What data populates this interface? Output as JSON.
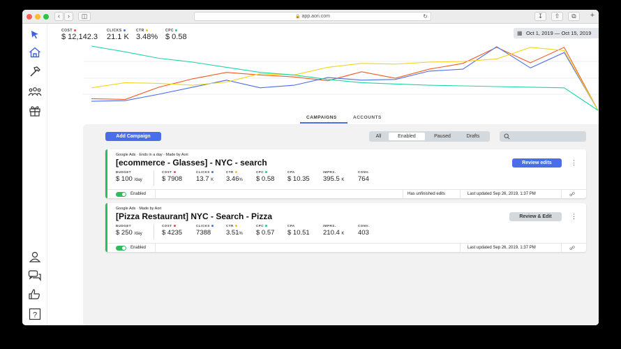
{
  "browser": {
    "url": "app.aori.com"
  },
  "header_metrics": [
    {
      "label": "COST",
      "value": "$ 12,142.3",
      "dot_color": "#e84a4a"
    },
    {
      "label": "CLICKS",
      "value": "21.1 K",
      "dot_color": "#4a6ee8"
    },
    {
      "label": "CTR",
      "value": "3.48%",
      "dot_color": "#f2c21b"
    },
    {
      "label": "CPC",
      "value": "$ 0.58",
      "dot_color": "#1bc9a0"
    }
  ],
  "date_range": "Oct 1, 2019 — Oct 15, 2019",
  "chart_data": {
    "type": "line",
    "series": [
      {
        "name": "COST",
        "color": "#f25a22",
        "values": [
          18,
          17,
          36,
          49,
          59,
          55,
          52,
          46,
          60,
          50,
          64,
          73,
          98,
          74,
          98,
          0
        ]
      },
      {
        "name": "CLICKS",
        "color": "#4a6ee8",
        "values": [
          14,
          15,
          25,
          36,
          47,
          35,
          39,
          51,
          47,
          48,
          61,
          64,
          99,
          66,
          90,
          0
        ]
      },
      {
        "name": "CTR",
        "color": "#f2d61b",
        "values": [
          35,
          43,
          42,
          39,
          44,
          57,
          55,
          67,
          73,
          72,
          75,
          76,
          80,
          98,
          93,
          0
        ]
      },
      {
        "name": "CPC",
        "color": "#1bd6a8",
        "values": [
          100,
          91,
          81,
          75,
          67,
          59,
          55,
          48,
          43,
          41,
          39,
          38,
          37,
          36,
          35,
          0
        ]
      }
    ]
  },
  "tabs": [
    {
      "label": "CAMPAIGNS"
    },
    {
      "label": "ACCOUNTS"
    }
  ],
  "toolbar": {
    "add_label": "Add Campaign",
    "filters": [
      "All",
      "Enabled",
      "Paused",
      "Drafts"
    ]
  },
  "campaigns": [
    {
      "meta": "Google Ads · Ends in a day · Made by Aori",
      "title": "[ecommerce - Glasses] - NYC - search",
      "budget_label": "BUDGET",
      "budget": "$ 100",
      "budget_unit": "/day",
      "stats": [
        {
          "label": "COST",
          "value": "$ 7908",
          "dot": "#e84a4a"
        },
        {
          "label": "CLICKS",
          "value": "13.7",
          "suffix": "K",
          "dot": "#4a6ee8"
        },
        {
          "label": "CTR",
          "value": "3.46",
          "suffix": "%",
          "dot": "#f2c21b"
        },
        {
          "label": "CPC",
          "value": "$ 0.58",
          "dot": "#1bc9a0"
        },
        {
          "label": "CPA",
          "value": "$ 10.35"
        },
        {
          "label": "IMPRS.",
          "value": "395.5",
          "suffix": "K"
        },
        {
          "label": "CONV.",
          "value": "764"
        }
      ],
      "status": "Enabled",
      "note": "Has unfinished edits",
      "updated": "Last updated Sep 26, 2019, 1:37 PM",
      "action": "Review edits"
    },
    {
      "meta": "Google Ads · Made by Aori",
      "title": "[Pizza Restaurant] NYC - Search - Pizza",
      "budget_label": "BUDGET",
      "budget": "$ 250",
      "budget_unit": "/day",
      "stats": [
        {
          "label": "COST",
          "value": "$ 4235",
          "dot": "#e84a4a"
        },
        {
          "label": "CLICKS",
          "value": "7388",
          "dot": "#4a6ee8"
        },
        {
          "label": "CTR",
          "value": "3.51",
          "suffix": "%",
          "dot": "#f2c21b"
        },
        {
          "label": "CPC",
          "value": "$ 0.57",
          "dot": "#1bc9a0"
        },
        {
          "label": "CPA",
          "value": "$ 10.51"
        },
        {
          "label": "IMPRS.",
          "value": "210.4",
          "suffix": "K"
        },
        {
          "label": "CONV.",
          "value": "403"
        }
      ],
      "status": "Enabled",
      "note": "",
      "updated": "Last updated Sep 26, 2019, 1:37 PM",
      "action": "Review & Edit"
    }
  ],
  "colors": {
    "accent": "#4a6ee8",
    "enabled_green": "#2ebd5e"
  }
}
